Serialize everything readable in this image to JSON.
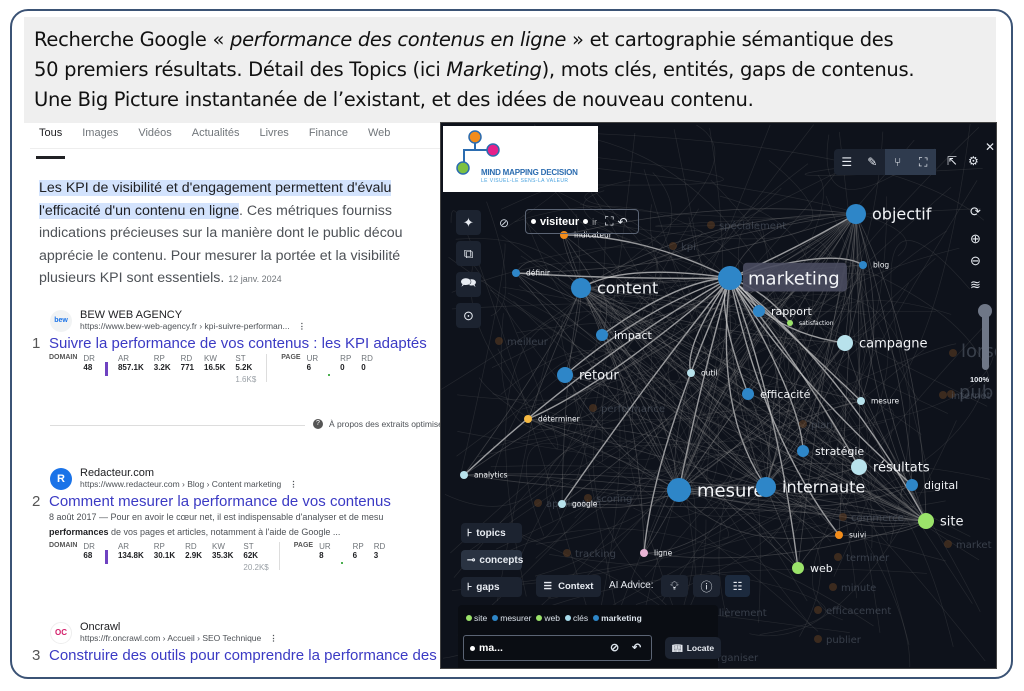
{
  "caption": {
    "line1_prefix": "Recherche Google « ",
    "line1_query": "performance des contenus en ligne",
    "line1_suffix": " » et cartographie sémantique des",
    "line2_prefix": "50 premiers résultats. Détail des Topics (ici ",
    "line2_topic": "Marketing",
    "line2_suffix": "), mots clés, entités, gaps de contenus.",
    "line3": "Une Big Picture instantanée de l’existant, et des idées de nouveau contenu."
  },
  "serp": {
    "tabs": [
      "Tous",
      "Images",
      "Vidéos",
      "Actualités",
      "Livres",
      "Finance",
      "Web"
    ],
    "active_tab": "Tous",
    "snippet": {
      "highlight_1": "Les KPI de visibilité et d'engagement permettent d'évalu",
      "highlight_2": "l'efficacité d'un contenu en ligne",
      "rest_2": ". Ces métriques fourniss",
      "line3": "indications précieuses sur la manière dont le public décou",
      "line4": "apprécie le contenu. Pour mesurer la portée et la visibilité",
      "line5": "plusieurs KPI sont essentiels.",
      "date": "12 janv. 2024"
    },
    "about_label": "À propos des extraits optimisé",
    "metric_labels": {
      "domain": "DOMAIN",
      "page": "PAGE",
      "dr": "DR",
      "ar": "AR",
      "rp": "RP",
      "rd": "RD",
      "kw": "KW",
      "st": "ST",
      "ur": "UR"
    },
    "results": [
      {
        "rank": "1",
        "site": "BEW WEB AGENCY",
        "favicon": "bew",
        "url": "https://www.bew-web-agency.fr › kpi-suivre-performan...",
        "title": "Suivre la performance de vos contenus : les KPI adaptés",
        "desc1": "",
        "desc_bold": "",
        "desc2": "",
        "domain": {
          "dr": "48",
          "ar": "857.1K",
          "rp": "3.2K",
          "rd": "771",
          "kw": "16.5K",
          "st": "5.2K",
          "st_value": "1.6K$"
        },
        "page": {
          "ur": "6",
          "rp": "0",
          "rd": "0"
        }
      },
      {
        "rank": "2",
        "site": "Redacteur.com",
        "favicon": "R",
        "url": "https://www.redacteur.com › Blog › Content marketing",
        "title": "Comment mesurer la performance de vos contenus",
        "desc1": "8 août 2017 — Pour en avoir le cœur net, il est indispensable d'analyser et de mesu",
        "desc_bold": "performances",
        "desc2": " de vos pages et articles, notamment à l'aide de Google ...",
        "domain": {
          "dr": "68",
          "ar": "134.8K",
          "rp": "30.1K",
          "rd": "2.9K",
          "kw": "35.3K",
          "st": "62K",
          "st_value": "20.2K$"
        },
        "page": {
          "ur": "8",
          "rp": "6",
          "rd": "3"
        }
      },
      {
        "rank": "3",
        "site": "Oncrawl",
        "favicon": "OC",
        "url": "https://fr.oncrawl.com › Accueil › SEO Technique",
        "title": "Construire des outils pour comprendre la performance des"
      }
    ]
  },
  "mindmap": {
    "logo_title": "MIND MAPPING DECISION",
    "logo_subtitle": "LE VISUEL-LE SENS-LA VALEUR",
    "focus_items": [
      "visiteur",
      "ir"
    ],
    "zoom_level": "100%",
    "modes": [
      {
        "label": "topics",
        "icon": "topics-icon"
      },
      {
        "label": "concepts",
        "icon": "concepts-icon"
      },
      {
        "label": "gaps",
        "icon": "gaps-icon"
      }
    ],
    "context_label": "Context",
    "ai_advice_label": "AI Advice:",
    "chips": [
      {
        "label": "site",
        "color": "#9be36a"
      },
      {
        "label": "mesurer",
        "color": "#2e86c8"
      },
      {
        "label": "web",
        "color": "#9be36a"
      },
      {
        "label": "clés",
        "color": "#a8dcec"
      },
      {
        "label": "marketing",
        "color": "#2e86c8"
      }
    ],
    "search_value": "ma...",
    "locate_label": "Locate",
    "colors": {
      "blue": "#2e86c8",
      "light": "#b8e2ec",
      "green": "#9be36a",
      "orange": "#f28c1b",
      "yellow": "#f5b942",
      "pink": "#e8b4d4",
      "brown": "#7a4a2a"
    },
    "nodes": [
      {
        "label": "marketing",
        "color": "blue",
        "size": "xl",
        "highlight": true
      },
      {
        "label": "objectif",
        "color": "blue",
        "size": "l"
      },
      {
        "label": "content",
        "color": "blue",
        "size": "l"
      },
      {
        "label": "mesurer",
        "color": "blue",
        "size": "xl"
      },
      {
        "label": "internaute",
        "color": "blue",
        "size": "l"
      },
      {
        "label": "résultats",
        "color": "light",
        "size": "m"
      },
      {
        "label": "campagne",
        "color": "light",
        "size": "m"
      },
      {
        "label": "site",
        "color": "green",
        "size": "m"
      },
      {
        "label": "retour",
        "color": "blue",
        "size": "m"
      },
      {
        "label": "impact",
        "color": "blue",
        "size": "s"
      },
      {
        "label": "rapport",
        "color": "blue",
        "size": "s"
      },
      {
        "label": "efficacité",
        "color": "blue",
        "size": "s"
      },
      {
        "label": "stratégie",
        "color": "blue",
        "size": "s"
      },
      {
        "label": "digital",
        "color": "blue",
        "size": "s"
      },
      {
        "label": "blog",
        "color": "blue",
        "size": "xs"
      },
      {
        "label": "définir",
        "color": "blue",
        "size": "xs"
      },
      {
        "label": "web",
        "color": "green",
        "size": "s"
      },
      {
        "label": "déterminer",
        "color": "yellow",
        "size": "xs"
      },
      {
        "label": "analytics",
        "color": "light",
        "size": "xs"
      },
      {
        "label": "google",
        "color": "light",
        "size": "xs"
      },
      {
        "label": "outil",
        "color": "light",
        "size": "xs"
      },
      {
        "label": "mesure",
        "color": "light",
        "size": "xs"
      },
      {
        "label": "ligne",
        "color": "pink",
        "size": "xs"
      },
      {
        "label": "suivi",
        "color": "orange",
        "size": "xs"
      },
      {
        "label": "indicateur",
        "color": "orange",
        "size": "xs"
      },
      {
        "label": "satisfaction",
        "color": "green",
        "size": "xxs"
      }
    ],
    "faded_labels": [
      "spécialement",
      "kpi",
      "meilleur",
      "performance",
      "application",
      "scoring",
      "tracking",
      "lorsque",
      "pub",
      "market",
      "terminer",
      "minute",
      "efficacement",
      "publier",
      "organiser",
      "régulièrement",
      "commerce",
      "internet",
      "plan"
    ]
  }
}
